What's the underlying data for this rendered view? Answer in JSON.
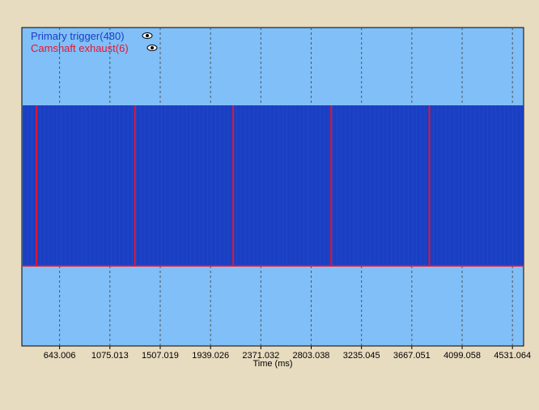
{
  "chart_data": {
    "type": "line",
    "title": "",
    "xlabel": "Time (ms)",
    "ylabel": "",
    "x_ticks": [
      "643.006",
      "1075.013",
      "1507.019",
      "1939.026",
      "2371.032",
      "2803.038",
      "3235.045",
      "3667.051",
      "4099.058",
      "4531.064"
    ],
    "xlim": [
      319.0,
      4627.0
    ],
    "grid": true,
    "legend_position": "top-left",
    "series": [
      {
        "name": "Primary trigger(480)",
        "color": "#1a3fc2",
        "signal": "square-wave",
        "pulse_count": 480
      },
      {
        "name": "Camshaft exhaust(6)",
        "color": "#e8142e",
        "signal": "pulse",
        "pulse_count": 6,
        "pulse_times_ms": [
          445,
          1290,
          2134,
          2975,
          3818
        ]
      }
    ],
    "colors": {
      "plot_background": "#80bff8",
      "page_background": "#e8dcc0",
      "trigger_band": "#1a3fc2",
      "cam_line": "#e8142e",
      "grid": "#555555"
    }
  }
}
